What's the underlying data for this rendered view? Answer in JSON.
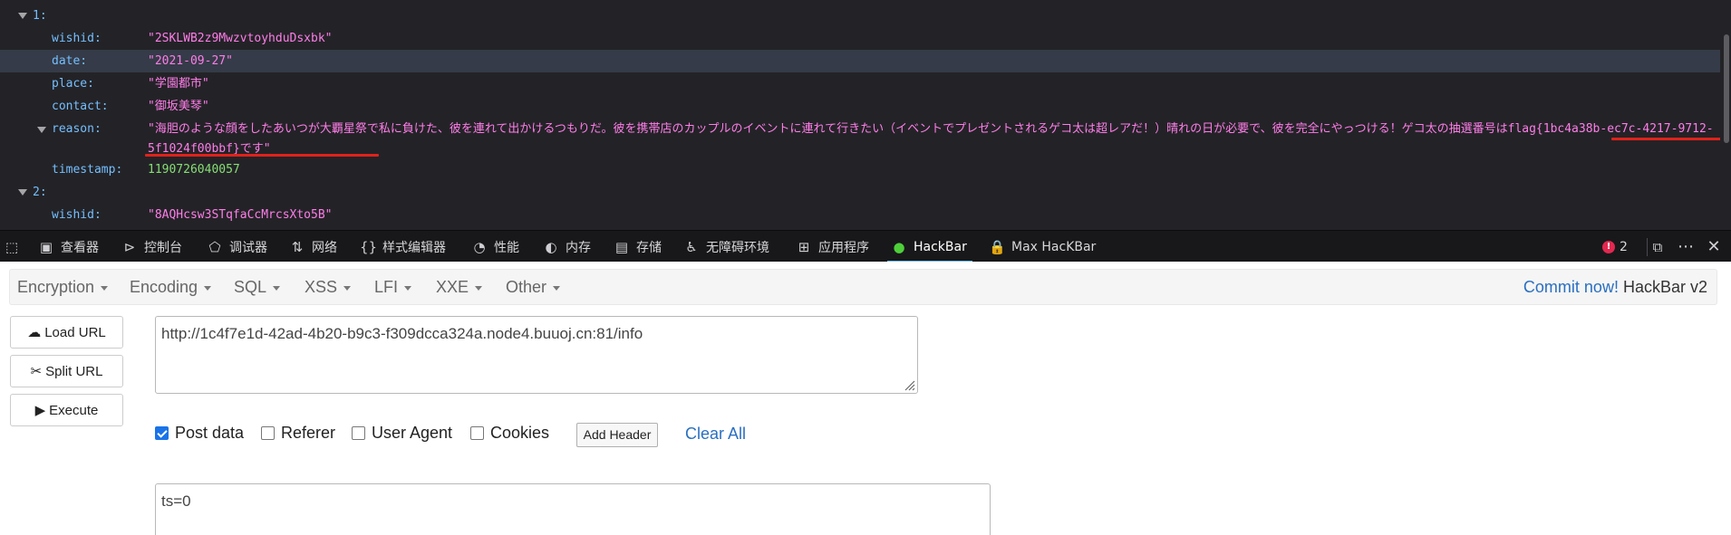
{
  "json_viewer": {
    "entry1_key": "1:",
    "wishid_key": "wishid:",
    "wishid_value": "\"2SKLWB2z9MwzvtoyhduDsxbk\"",
    "date_key": "date:",
    "date_value": "\"2021-09-27\"",
    "place_key": "place:",
    "place_value": "\"学園都市\"",
    "contact_key": "contact:",
    "contact_value": "\"御坂美琴\"",
    "reason_key": "reason:",
    "reason_value": "\"海胆のような顔をしたあいつが大覇星祭で私に負けた、彼を連れて出かけるつもりだ。彼を携帯店のカップルのイベントに連れて行きたい（イベントでプレゼントされるゲコ太は超レアだ！）晴れの日が必要で、彼を完全にやっつける！ゲコ太の抽選番号はflag{1bc4a38b-ec7c-4217-9712-5f1024f00bbf}です\"",
    "timestamp_key": "timestamp:",
    "timestamp_value": "1190726040057",
    "entry2_key": "2:",
    "wishid2_key": "wishid:",
    "wishid2_value": "\"8AQHcsw3STqfaCcMrcsXto5B\""
  },
  "devtools": {
    "tabs": [
      {
        "label": "查看器",
        "icon": "inspector-icon"
      },
      {
        "label": "控制台",
        "icon": "console-icon"
      },
      {
        "label": "调试器",
        "icon": "debugger-icon"
      },
      {
        "label": "网络",
        "icon": "network-icon"
      },
      {
        "label": "样式编辑器",
        "icon": "style-editor-icon"
      },
      {
        "label": "性能",
        "icon": "performance-icon"
      },
      {
        "label": "内存",
        "icon": "memory-icon"
      },
      {
        "label": "存储",
        "icon": "storage-icon"
      },
      {
        "label": "无障碍环境",
        "icon": "accessibility-icon"
      },
      {
        "label": "应用程序",
        "icon": "application-icon"
      },
      {
        "label": "HackBar",
        "icon": "hackbar-icon"
      },
      {
        "label": "Max HacKBar",
        "icon": "lock-icon"
      }
    ],
    "active_tab": "HackBar",
    "error_count": "2"
  },
  "hackbar": {
    "menu": [
      "Encryption",
      "Encoding",
      "SQL",
      "XSS",
      "LFI",
      "XXE",
      "Other"
    ],
    "commit_link": "Commit now!",
    "commit_suffix": " HackBar v2",
    "buttons": {
      "load_url": "Load URL",
      "split_url": "Split URL",
      "execute": "Execute"
    },
    "url": "http://1c4f7e1d-42ad-4b20-b9c3-f309dcca324a.node4.buuoj.cn:81/info",
    "options": {
      "post_data": "Post data",
      "post_data_checked": true,
      "referer": "Referer",
      "user_agent": "User Agent",
      "cookies": "Cookies"
    },
    "add_header": "Add Header",
    "clear_all": "Clear All",
    "post_body": "ts=0"
  },
  "colors": {
    "json_bg": "#232327",
    "json_key": "#75bfff",
    "json_string": "#ff7de9",
    "json_number": "#86de74",
    "underline": "#e0221b",
    "link": "#2a6fc1",
    "checkbox_on": "#1a73e8"
  }
}
